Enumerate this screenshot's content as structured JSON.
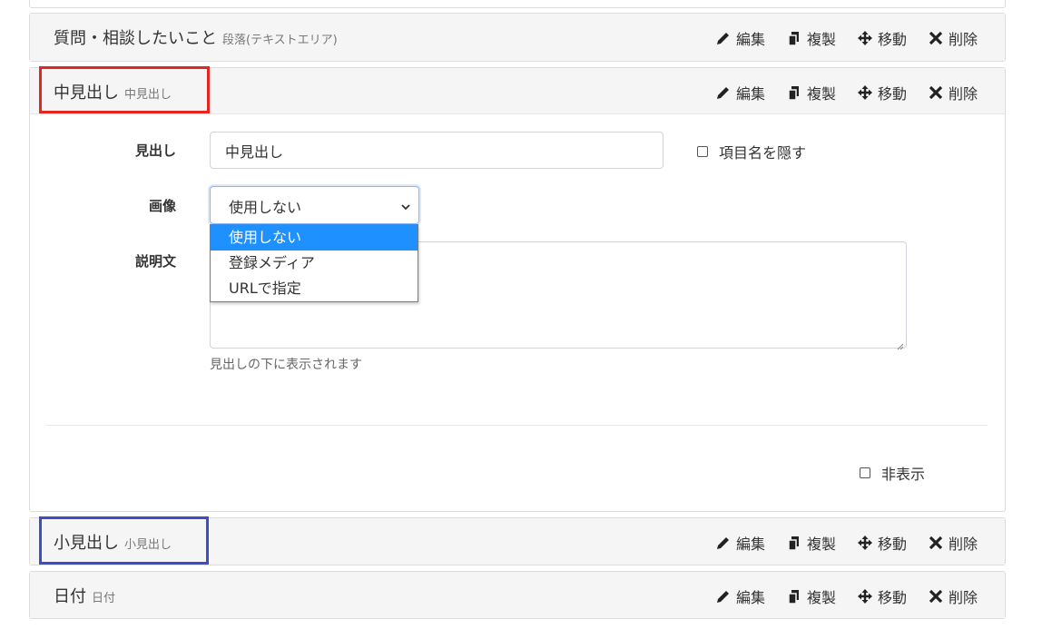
{
  "rows": {
    "textarea_row": {
      "title": "質問・相談したいこと",
      "subtitle": "段落(テキストエリア)"
    },
    "mid_heading": {
      "title": "中見出し",
      "subtitle": "中見出し"
    },
    "small_heading": {
      "title": "小見出し",
      "subtitle": "小見出し"
    },
    "date_row": {
      "title": "日付",
      "subtitle": "日付"
    }
  },
  "actions": {
    "edit": "編集",
    "duplicate": "複製",
    "move": "移動",
    "delete": "削除"
  },
  "form": {
    "heading_label": "見出し",
    "heading_value": "中見出し",
    "hide_item_name": "項目名を隠す",
    "image_label": "画像",
    "image_selected": "使用しない",
    "image_options": [
      "使用しない",
      "登録メディア",
      "URLで指定"
    ],
    "description_label": "説明文",
    "description_help": "見出しの下に表示されます",
    "hidden_label": "非表示"
  },
  "colors": {
    "highlight_red": "#e52521",
    "highlight_blue": "#3a4fc7",
    "option_selected": "#1e90ff"
  },
  "icons": {
    "edit": "pencil-icon",
    "duplicate": "copy-icon",
    "move": "move-arrows-icon",
    "delete": "close-icon"
  }
}
